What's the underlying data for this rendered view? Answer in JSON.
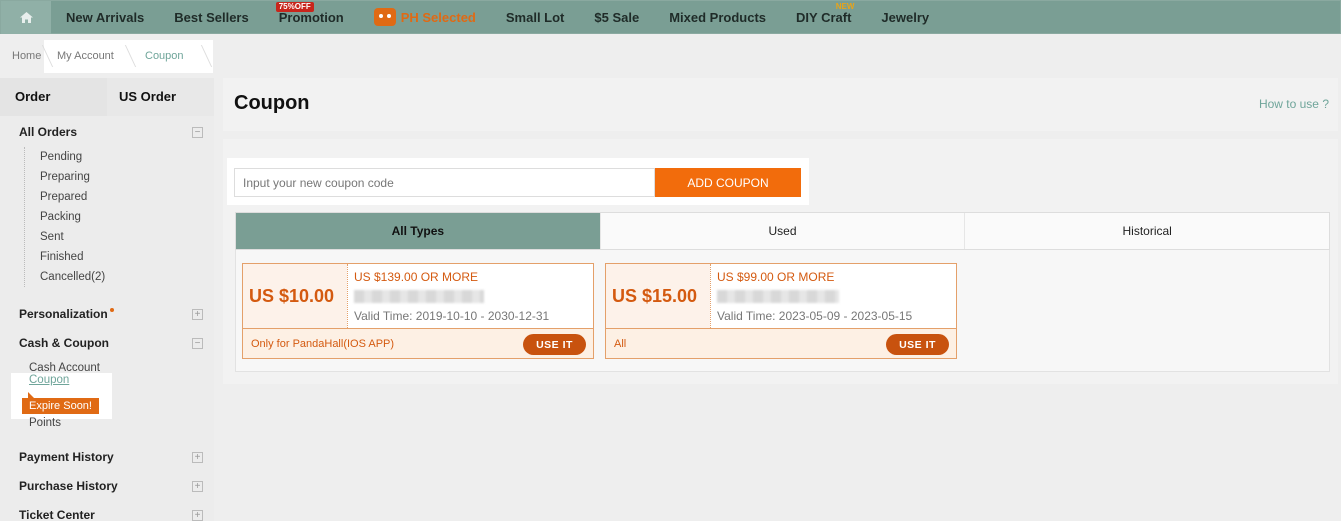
{
  "nav": {
    "items": [
      "New Arrivals",
      "Best Sellers",
      "Promotion",
      "PH Selected",
      "Small Lot",
      "$5 Sale",
      "Mixed Products",
      "DIY Craft",
      "Jewelry"
    ],
    "promotion_tag": "75%OFF",
    "diy_tag": "NEW"
  },
  "breadcrumb": {
    "home": "Home",
    "my_account": "My Account",
    "current": "Coupon"
  },
  "sidebar": {
    "tabs": [
      "Order",
      "US Order"
    ],
    "all_orders": "All Orders",
    "order_items": [
      "Pending",
      "Preparing",
      "Prepared",
      "Packing",
      "Sent",
      "Finished",
      "Cancelled(2)"
    ],
    "personalization": "Personalization",
    "cash_coupon": "Cash & Coupon",
    "cash_account": "Cash Account",
    "coupon": "Coupon",
    "expire_tip": "Expire Soon!",
    "points": "Points",
    "payment_history": "Payment History",
    "purchase_history": "Purchase History",
    "ticket_center": "Ticket Center"
  },
  "main": {
    "title": "Coupon",
    "how_to_use": "How to use ?",
    "input_placeholder": "Input your new coupon code",
    "add_button": "ADD COUPON",
    "type_tabs": [
      "All Types",
      "Used",
      "Historical"
    ]
  },
  "coupons": [
    {
      "amount": "US $10.00",
      "requirement": "US $139.00 OR MORE",
      "valid": "Valid Time: 2019-10-10 - 2030-12-31",
      "note": "Only for PandaHall(IOS APP)",
      "button": "USE IT"
    },
    {
      "amount": "US $15.00",
      "requirement": "US $99.00 OR MORE",
      "valid": "Valid Time: 2023-05-09 - 2023-05-15",
      "note": "All",
      "button": "USE IT"
    }
  ],
  "colors": {
    "nav_bg": "#7a9e94",
    "accent_orange": "#f26c0c",
    "link_teal": "#6fa59a"
  }
}
